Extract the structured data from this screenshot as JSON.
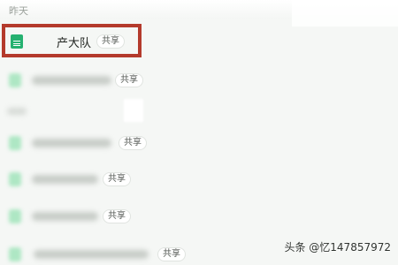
{
  "section": {
    "header": "昨天"
  },
  "files": [
    {
      "name_visible": "产大队",
      "badge": "共享",
      "icon": "sheet-icon",
      "blurred": false
    },
    {
      "badge": "共享",
      "icon": "sheet-icon",
      "blurred": true
    },
    {
      "badge": "共享",
      "icon": "sheet-icon",
      "blurred": true
    },
    {
      "badge": "共享",
      "icon": "sheet-icon",
      "blurred": true
    },
    {
      "badge": "共享",
      "icon": "sheet-icon",
      "blurred": true
    },
    {
      "badge": "共享",
      "icon": "sheet-icon",
      "blurred": true
    }
  ],
  "watermark": "头条 @忆147857972",
  "colors": {
    "accent_green": "#25b170",
    "highlight_red": "#b43a2c",
    "background": "#f5f7f5"
  }
}
